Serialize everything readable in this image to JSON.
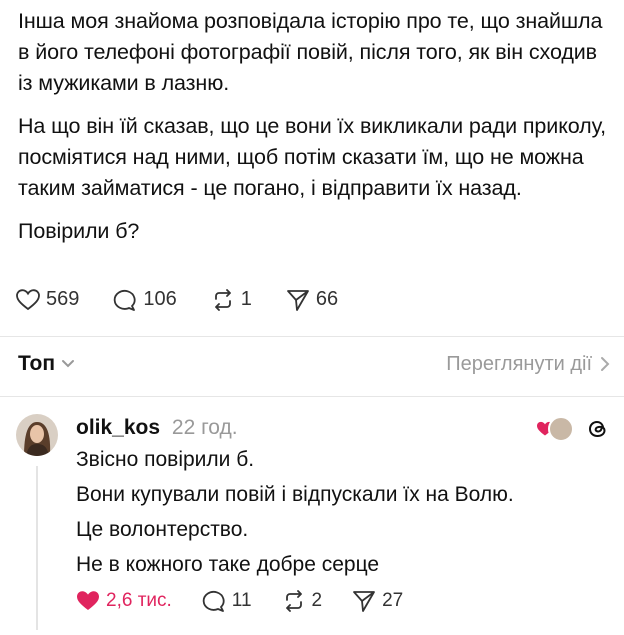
{
  "post": {
    "paragraphs": [
      "Інша моя знайома розповідала історію про те, що знайшла в його телефоні фотографії повій, після того, як він сходив із мужиками в лазню.",
      "На що він їй сказав, що це вони їх викликали ради приколу, посміятися над ними, щоб потім сказати їм, що не можна таким займатися - це погано, і відправити їх назад.",
      "Повірили б?"
    ],
    "likes": "569",
    "comments": "106",
    "reposts": "1",
    "shares": "66"
  },
  "sort": {
    "label": "Топ",
    "view_activity": "Переглянути дії"
  },
  "comment": {
    "username": "olik_kos",
    "time": "22 год.",
    "lines": [
      "Звісно повірили б.",
      "Вони купували повій і відпускали їх на Волю.",
      "Це волонтерство.",
      "Не в кожного таке добре серце"
    ],
    "likes": "2,6 тис.",
    "comments": "11",
    "reposts": "2",
    "shares": "27"
  },
  "colors": {
    "like": "#e0245e",
    "muted": "#999999"
  },
  "icons": [
    "heart-icon",
    "comment-icon",
    "repost-icon",
    "share-icon",
    "chevron-down-icon",
    "chevron-right-icon",
    "threads-icon"
  ]
}
